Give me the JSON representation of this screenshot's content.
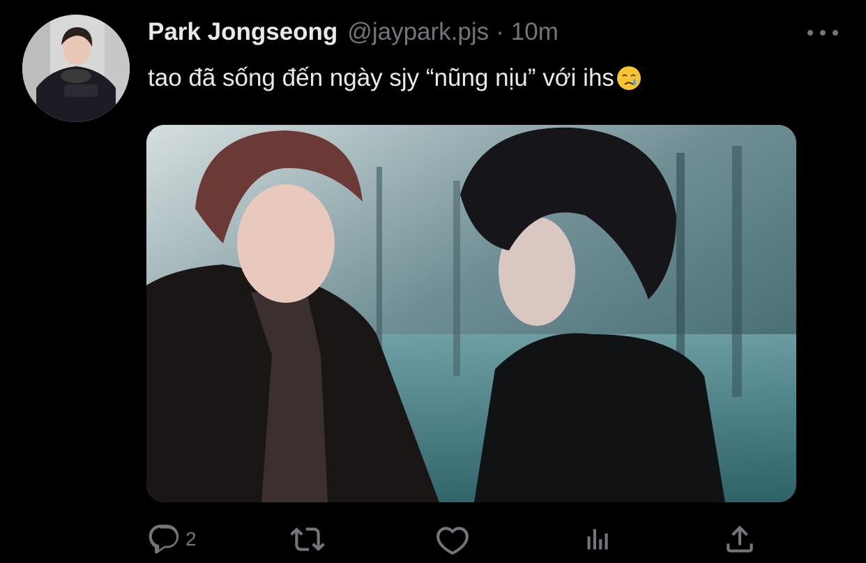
{
  "tweet": {
    "author_name": "Park Jongseong",
    "handle": "@jaypark.pjs",
    "separator": "·",
    "time": "10m",
    "text": "tao đã sống đến ngày sjy “nũng nịu” với ihs",
    "emoji": "crying-face",
    "media_alt": "Two young men facing each other in an airport terminal"
  },
  "actions": {
    "reply_count": "2",
    "retweet_count": "",
    "like_count": ""
  },
  "colors": {
    "background": "#000000",
    "primary_text": "#e7e9ea",
    "secondary_text": "#71767b"
  }
}
